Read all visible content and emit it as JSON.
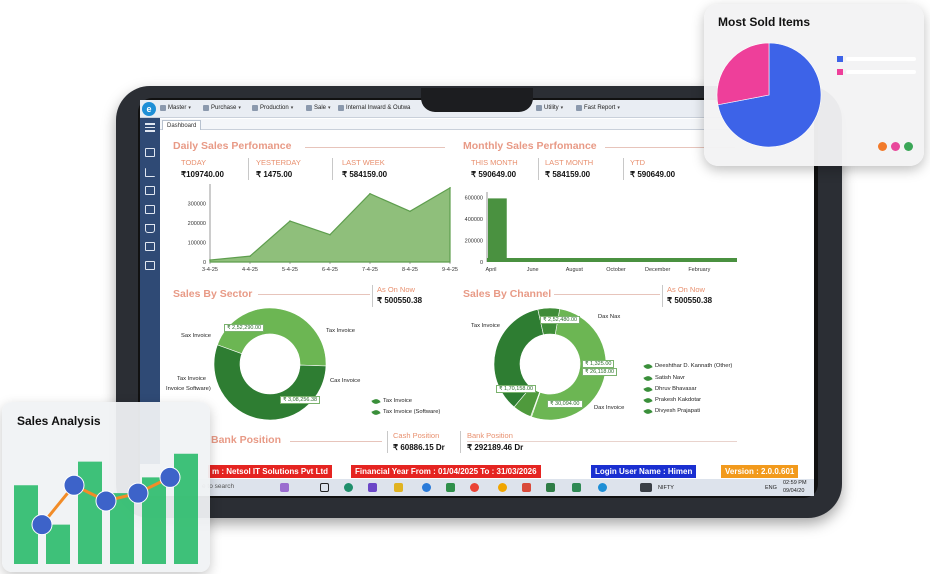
{
  "menubar": {
    "items": [
      {
        "label": "Master",
        "icon": "master-icon"
      },
      {
        "label": "Purchase",
        "icon": "purchase-icon"
      },
      {
        "label": "Production",
        "icon": "production-icon"
      },
      {
        "label": "Sale",
        "icon": "sale-icon"
      },
      {
        "label": "Internal Inward & Outwa",
        "icon": "inward-outward-icon"
      },
      {
        "label": "Utility",
        "icon": "utility-icon"
      },
      {
        "label": "Fast Report",
        "icon": "fast-report-icon"
      }
    ]
  },
  "tab": {
    "label": "Dashboard"
  },
  "daily_sales": {
    "title": "Daily Sales Perfomance",
    "kpis": [
      {
        "label": "TODAY",
        "value": "₹109740.00"
      },
      {
        "label": "YESTERDAY",
        "value": "₹ 1475.00"
      },
      {
        "label": "LAST WEEK",
        "value": "₹ 584159.00"
      }
    ]
  },
  "monthly_sales": {
    "title": "Monthly Sales Perfomance",
    "kpis": [
      {
        "label": "THIS MONTH",
        "value": "₹ 590649.00"
      },
      {
        "label": "LAST MONTH",
        "value": "₹ 584159.00"
      },
      {
        "label": "YTD",
        "value": "₹ 590649.00"
      }
    ]
  },
  "sector": {
    "title": "Sales By Sector",
    "as_on_label": "As On Now",
    "as_on_value": "₹ 500550.38",
    "callouts": [
      "Sax Invoice",
      "Tax Invoice",
      "Cax Invoice",
      "Tax Invoice",
      "Invoice Software)"
    ],
    "slice_values": [
      "₹ 2,52,290.00",
      "₹ 3,08,256.38"
    ],
    "legend": [
      "Tax Invoice",
      "Tax Invoice (Software)"
    ]
  },
  "channel": {
    "title": "Sales By Channel",
    "as_on_label": "As On Now",
    "as_on_value": "₹ 500550.38",
    "callouts": [
      "Tax Invoice",
      "Dax Nax",
      "Dax Invoice"
    ],
    "slice_values": [
      "₹ 2,52,480.00",
      "₹ 1,325.00",
      "₹ 26,118.00",
      "₹ 1,70,158.00",
      "₹ 30,094.00"
    ],
    "legend": [
      "Deeshthar D. Kannath (Other)",
      "Satish Navr",
      "Dhruv Bhavasar",
      "Prakesh Kakdotar",
      "Divyesh Prajapati"
    ]
  },
  "bank": {
    "title_partial": "Bank Position",
    "cash_label": "Cash Position",
    "cash_value": "₹ 60886.15 Dr",
    "bank_label": "Bank Position",
    "bank_value": "₹ 292189.46 Dr"
  },
  "statusbar": {
    "company": "m : Netsol IT Solutions Pvt Ltd",
    "financial_year": "Financial Year From : 01/04/2025  To : 31/03/2026",
    "user": "Login User Name : Himen",
    "version": "Version : 2.0.0.601",
    "colors": {
      "company": "#e52421",
      "financial_year": "#e52421",
      "user": "#1a2fd1",
      "version": "#f29a1c"
    }
  },
  "taskbar": {
    "search_text": "e to search",
    "nifty": "NIFTY",
    "lang": "ENG",
    "time": "02:59 PM",
    "date": "09/04/20"
  },
  "cards": {
    "most_sold": {
      "title": "Most Sold Items"
    },
    "sales_analysis": {
      "title": "Sales Analysis"
    }
  },
  "chart_data": [
    {
      "type": "area",
      "name": "daily-sales",
      "x": [
        "3-4-25",
        "4-4-25",
        "5-4-25",
        "6-4-25",
        "7-4-25",
        "8-4-25",
        "9-4-25"
      ],
      "values": [
        10000,
        30000,
        210000,
        140000,
        350000,
        260000,
        380000
      ],
      "yticks": [
        0,
        100000,
        200000,
        300000
      ],
      "ylim": [
        0,
        400000
      ],
      "color": "#5e9e4e"
    },
    {
      "type": "bar",
      "name": "monthly-sales",
      "x": [
        "April",
        "June",
        "August",
        "October",
        "December",
        "February"
      ],
      "values": [
        590649,
        0,
        0,
        0,
        0,
        0
      ],
      "yticks": [
        0,
        200000,
        400000,
        600000
      ],
      "ylim": [
        0,
        650000
      ],
      "color": "#4a9140"
    },
    {
      "type": "pie",
      "name": "sales-by-sector",
      "values": [
        252290.0,
        308256.38
      ],
      "colors": [
        "#6cb653",
        "#2e7d32"
      ]
    },
    {
      "type": "pie",
      "name": "sales-by-channel",
      "values": [
        252480.0,
        1325.0,
        26118.0,
        170158.0,
        30094.0
      ],
      "colors": [
        "#6cb653",
        "#8fce6b",
        "#4f9a3c",
        "#2e7d32",
        "#3f8c38"
      ]
    },
    {
      "type": "pie",
      "name": "most-sold-items",
      "values": [
        72,
        28
      ],
      "colors": [
        "#3d63e8",
        "#ee3f9a"
      ]
    },
    {
      "type": "bar",
      "name": "sales-analysis",
      "values": [
        5,
        2.5,
        6.5,
        4.5,
        5.5,
        7
      ],
      "line": [
        2.5,
        5,
        4,
        4.5,
        5.5
      ],
      "ylim": [
        0,
        8
      ],
      "colors": {
        "bar": "#2fbd6e",
        "line": "#f28c28",
        "marker": "#3d63c9"
      }
    }
  ]
}
